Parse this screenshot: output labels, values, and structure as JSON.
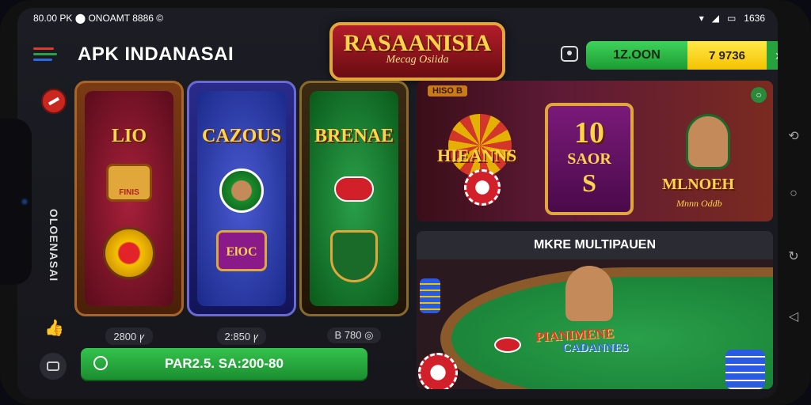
{
  "statusbar": {
    "left": "80.00 PK ⬤ ONOAMT 8886 ©",
    "right": "1636"
  },
  "header": {
    "title": "APK INDANASAI"
  },
  "logo": {
    "main": "RASAANISIA",
    "sub": "Mecag Osiida"
  },
  "balance": {
    "amount": "1Z.OON",
    "secondary": "7 9736",
    "arrow": "›"
  },
  "sidebar": {
    "vertical_label": "OLOENASAI"
  },
  "cards": [
    {
      "name": "LIO",
      "price": "2800 ꝩ",
      "theme": "red"
    },
    {
      "name": "CAZOUS",
      "price": "2:850 ꝩ",
      "theme": "blue"
    },
    {
      "name": "BRENAE",
      "price": "B 780 ◎",
      "theme": "green"
    }
  ],
  "cards_art": {
    "tag1": "FINIS",
    "tag2": "ElOC"
  },
  "play_button": {
    "label": "PAR2.5. SA:200-80"
  },
  "promo": {
    "tag": "HISO B",
    "left_title": "HIEANNS",
    "box_number": "10",
    "box_word": "SAOR",
    "box_symbol": "S",
    "right_title": "MLNOEH",
    "right_sub": "Mnnn Oddb"
  },
  "multiplayer": {
    "title": "MKRE MULTIPAUEN",
    "line1": "PIANIMENE",
    "line2": "CADANNES"
  },
  "colors": {
    "accent_green": "#2bb544",
    "accent_yellow": "#f5c200",
    "gold": "#ffd34a"
  }
}
